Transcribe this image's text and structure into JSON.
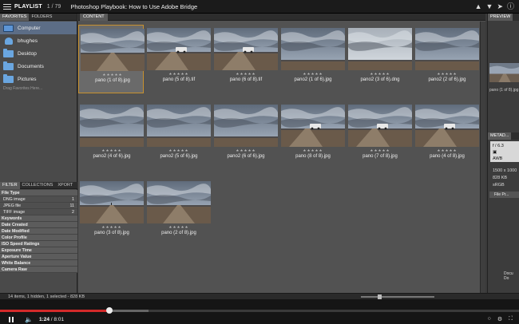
{
  "player": {
    "playlist_label": "PLAYLIST",
    "position": "1 / 79",
    "title": "Photoshop Playbook: How to Use Adobe Bridge",
    "icons": [
      "thumbs-up-icon",
      "thumbs-down-icon",
      "share-icon",
      "info-icon"
    ]
  },
  "left_panel": {
    "tabs": [
      "FAVORITES",
      "FOLDERS"
    ],
    "favorites": [
      {
        "label": "Computer",
        "icon": "monitor-icon",
        "selected": true
      },
      {
        "label": "bhughes",
        "icon": "user-icon"
      },
      {
        "label": "Desktop",
        "icon": "folder-icon"
      },
      {
        "label": "Documents",
        "icon": "folder-icon"
      },
      {
        "label": "Pictures",
        "icon": "folder-icon"
      }
    ],
    "drag_hint": "Drag Favorites Here...",
    "filter_tabs": [
      "FILTER",
      "COLLECTIONS",
      "XPORT"
    ],
    "filters": [
      {
        "label": "File Type",
        "type": "header"
      },
      {
        "label": "DNG image",
        "count": "1",
        "type": "sub"
      },
      {
        "label": "JPEG file",
        "count": "11",
        "type": "sub"
      },
      {
        "label": "TIFF image",
        "count": "2",
        "type": "sub"
      },
      {
        "label": "Keywords",
        "type": "header"
      },
      {
        "label": "Date Created",
        "type": "header"
      },
      {
        "label": "Date Modified",
        "type": "header"
      },
      {
        "label": "Color Profile",
        "type": "header"
      },
      {
        "label": "ISO Speed Ratings",
        "type": "header"
      },
      {
        "label": "Exposure Time",
        "type": "header"
      },
      {
        "label": "Aperture Value",
        "type": "header"
      },
      {
        "label": "White Balance",
        "type": "header"
      },
      {
        "label": "Camera Raw",
        "type": "header"
      }
    ]
  },
  "content": {
    "tab": "CONTENT",
    "stars": "★★★★★",
    "thumbnails": [
      {
        "name": "pano (1 of 8).jpg",
        "scene": "road",
        "selected": true
      },
      {
        "name": "pano (5 of 8).tif",
        "scene": "truck"
      },
      {
        "name": "pano (6 of 8).tif",
        "scene": "truck"
      },
      {
        "name": "pano2 (1 of 6).jpg",
        "scene": "sky"
      },
      {
        "name": "pano2 (3 of 6).dng",
        "scene": "sky-light"
      },
      {
        "name": "pano2 (2 of 6).jpg",
        "scene": "sky"
      },
      {
        "name": "pano2 (4 of 6).jpg",
        "scene": "sky"
      },
      {
        "name": "pano2 (5 of 6).jpg",
        "scene": "sky"
      },
      {
        "name": "pano2 (6 of 6).jpg",
        "scene": "sky"
      },
      {
        "name": "pano (8 of 8).jpg",
        "scene": "truck"
      },
      {
        "name": "pano (7 of 8).jpg",
        "scene": "truck"
      },
      {
        "name": "pano (4 of 8).jpg",
        "scene": "truck"
      },
      {
        "name": "pano (3 of 8).jpg",
        "scene": "person"
      },
      {
        "name": "pano (2 of 8).jpg",
        "scene": "road"
      }
    ]
  },
  "right_panel": {
    "preview_tab": "PREVIEW",
    "preview_caption": "pano (1 of 8).jpg",
    "metadata_tab": "METAD...",
    "meta_box": [
      "f / 6.3",
      "▣",
      "AWB"
    ],
    "meta_lines": [
      "1500 x 1000",
      "828 KB",
      "sRGB"
    ],
    "file_props": "File Pr...",
    "low_labels": [
      "Docu",
      "Do"
    ]
  },
  "status": {
    "text": "14 items, 1 hidden, 1 selected - 828 KB"
  },
  "video": {
    "current_time": "1:24",
    "duration": "8:01",
    "played_fraction": 0.21,
    "right_icons": [
      "captions-icon",
      "settings-icon",
      "fullscreen-icon"
    ]
  },
  "colors": {
    "selection_border": "#c8912e",
    "selected_favorite": "#5c6d86",
    "progress_played": "#d42a2a"
  }
}
